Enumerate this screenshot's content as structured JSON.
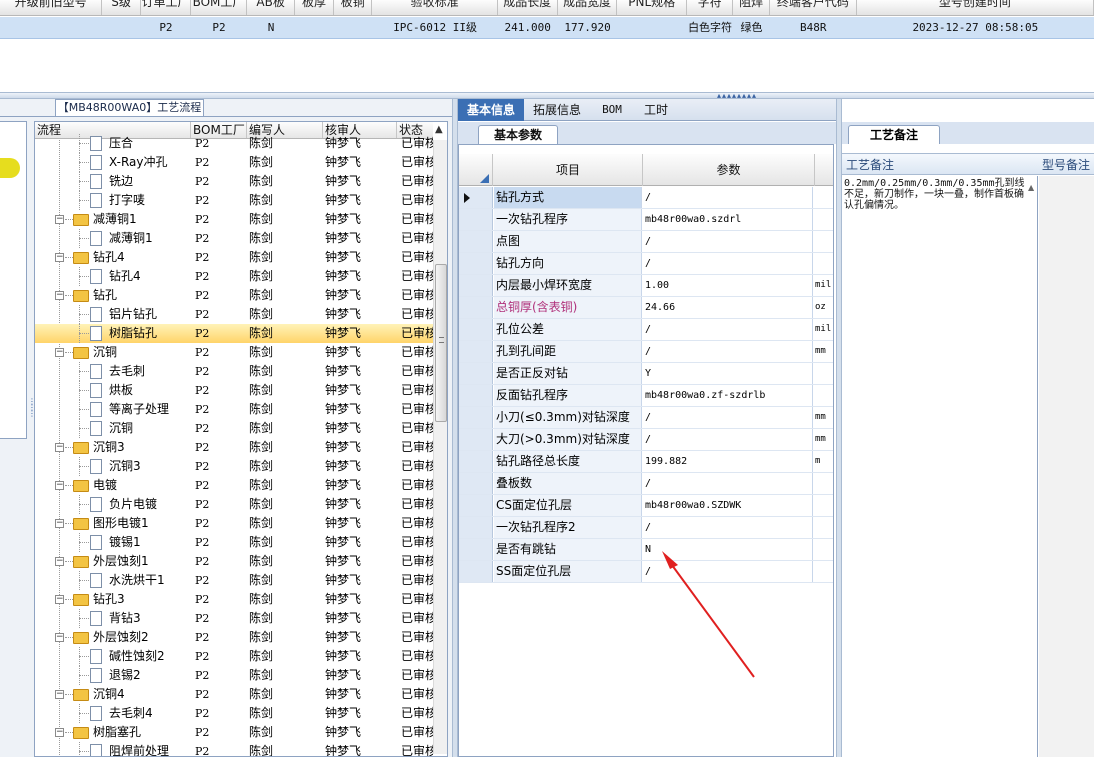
{
  "top_grid": {
    "headers": [
      "开级前旧型号",
      "S级",
      "订单工厂",
      "BOM工厂",
      "AB板",
      "板厚",
      "板铜",
      "验收标准",
      "成品长度",
      "成品宽度",
      "PNL规格",
      "字符",
      "阻焊",
      "终端客户代码",
      "型号创建时间"
    ],
    "row": [
      "",
      "",
      "P2",
      "P2",
      "N",
      "",
      "",
      "IPC-6012 II级",
      "241.000",
      "177.920",
      "",
      "白色字符",
      "绿色",
      "B48R",
      "2023-12-27 08:58:05"
    ]
  },
  "left_panel": {
    "tab_label": "【MB48R00WA0】工艺流程",
    "columns": [
      "流程",
      "BOM工厂",
      "编写人",
      "核审人",
      "状态"
    ],
    "rows": [
      {
        "level": 2,
        "name": "压合",
        "factory": "P2",
        "writer": "陈剑",
        "reviewer": "钟梦飞",
        "status": "已审核"
      },
      {
        "level": 2,
        "name": "X-Ray冲孔",
        "factory": "P2",
        "writer": "陈剑",
        "reviewer": "钟梦飞",
        "status": "已审核"
      },
      {
        "level": 2,
        "name": "铣边",
        "factory": "P2",
        "writer": "陈剑",
        "reviewer": "钟梦飞",
        "status": "已审核"
      },
      {
        "level": 2,
        "name": "打字唛",
        "factory": "P2",
        "writer": "陈剑",
        "reviewer": "钟梦飞",
        "status": "已审核"
      },
      {
        "level": 1,
        "name": "减薄铜1",
        "factory": "P2",
        "writer": "陈剑",
        "reviewer": "钟梦飞",
        "status": "已审核"
      },
      {
        "level": 2,
        "name": "减薄铜1",
        "factory": "P2",
        "writer": "陈剑",
        "reviewer": "钟梦飞",
        "status": "已审核"
      },
      {
        "level": 1,
        "name": "钻孔4",
        "factory": "P2",
        "writer": "陈剑",
        "reviewer": "钟梦飞",
        "status": "已审核"
      },
      {
        "level": 2,
        "name": "钻孔4",
        "factory": "P2",
        "writer": "陈剑",
        "reviewer": "钟梦飞",
        "status": "已审核"
      },
      {
        "level": 1,
        "name": "钻孔",
        "factory": "P2",
        "writer": "陈剑",
        "reviewer": "钟梦飞",
        "status": "已审核"
      },
      {
        "level": 2,
        "name": "铝片钻孔",
        "factory": "P2",
        "writer": "陈剑",
        "reviewer": "钟梦飞",
        "status": "已审核"
      },
      {
        "level": 2,
        "name": "树脂钻孔",
        "factory": "P2",
        "writer": "陈剑",
        "reviewer": "钟梦飞",
        "status": "已审核",
        "selected": true
      },
      {
        "level": 1,
        "name": "沉铜",
        "factory": "P2",
        "writer": "陈剑",
        "reviewer": "钟梦飞",
        "status": "已审核"
      },
      {
        "level": 2,
        "name": "去毛刺",
        "factory": "P2",
        "writer": "陈剑",
        "reviewer": "钟梦飞",
        "status": "已审核"
      },
      {
        "level": 2,
        "name": "烘板",
        "factory": "P2",
        "writer": "陈剑",
        "reviewer": "钟梦飞",
        "status": "已审核"
      },
      {
        "level": 2,
        "name": "等离子处理",
        "factory": "P2",
        "writer": "陈剑",
        "reviewer": "钟梦飞",
        "status": "已审核"
      },
      {
        "level": 2,
        "name": "沉铜",
        "factory": "P2",
        "writer": "陈剑",
        "reviewer": "钟梦飞",
        "status": "已审核"
      },
      {
        "level": 1,
        "name": "沉铜3",
        "factory": "P2",
        "writer": "陈剑",
        "reviewer": "钟梦飞",
        "status": "已审核"
      },
      {
        "level": 2,
        "name": "沉铜3",
        "factory": "P2",
        "writer": "陈剑",
        "reviewer": "钟梦飞",
        "status": "已审核"
      },
      {
        "level": 1,
        "name": "电镀",
        "factory": "P2",
        "writer": "陈剑",
        "reviewer": "钟梦飞",
        "status": "已审核"
      },
      {
        "level": 2,
        "name": "负片电镀",
        "factory": "P2",
        "writer": "陈剑",
        "reviewer": "钟梦飞",
        "status": "已审核"
      },
      {
        "level": 1,
        "name": "图形电镀1",
        "factory": "P2",
        "writer": "陈剑",
        "reviewer": "钟梦飞",
        "status": "已审核"
      },
      {
        "level": 2,
        "name": "镀锡1",
        "factory": "P2",
        "writer": "陈剑",
        "reviewer": "钟梦飞",
        "status": "已审核"
      },
      {
        "level": 1,
        "name": "外层蚀刻1",
        "factory": "P2",
        "writer": "陈剑",
        "reviewer": "钟梦飞",
        "status": "已审核"
      },
      {
        "level": 2,
        "name": "水洗烘干1",
        "factory": "P2",
        "writer": "陈剑",
        "reviewer": "钟梦飞",
        "status": "已审核"
      },
      {
        "level": 1,
        "name": "钻孔3",
        "factory": "P2",
        "writer": "陈剑",
        "reviewer": "钟梦飞",
        "status": "已审核"
      },
      {
        "level": 2,
        "name": "背钻3",
        "factory": "P2",
        "writer": "陈剑",
        "reviewer": "钟梦飞",
        "status": "已审核"
      },
      {
        "level": 1,
        "name": "外层蚀刻2",
        "factory": "P2",
        "writer": "陈剑",
        "reviewer": "钟梦飞",
        "status": "已审核"
      },
      {
        "level": 2,
        "name": "碱性蚀刻2",
        "factory": "P2",
        "writer": "陈剑",
        "reviewer": "钟梦飞",
        "status": "已审核"
      },
      {
        "level": 2,
        "name": "退锡2",
        "factory": "P2",
        "writer": "陈剑",
        "reviewer": "钟梦飞",
        "status": "已审核"
      },
      {
        "level": 1,
        "name": "沉铜4",
        "factory": "P2",
        "writer": "陈剑",
        "reviewer": "钟梦飞",
        "status": "已审核"
      },
      {
        "level": 2,
        "name": "去毛刺4",
        "factory": "P2",
        "writer": "陈剑",
        "reviewer": "钟梦飞",
        "status": "已审核"
      },
      {
        "level": 1,
        "name": "树脂塞孔",
        "factory": "P2",
        "writer": "陈剑",
        "reviewer": "钟梦飞",
        "status": "已审核"
      },
      {
        "level": 2,
        "name": "阻焊前处理",
        "factory": "P2",
        "writer": "陈剑",
        "reviewer": "钟梦飞",
        "status": "已审核"
      }
    ]
  },
  "middle_panel": {
    "tabs": [
      "基本信息",
      "拓展信息",
      "BOM",
      "工时"
    ],
    "active_tab": "基本信息",
    "sub_tab": "基本参数",
    "columns": [
      "项目",
      "参数"
    ],
    "rows": [
      {
        "name": "钻孔方式",
        "value": "/",
        "unit": ""
      },
      {
        "name": "一次钻孔程序",
        "value": "mb48r00wa0.szdrl",
        "unit": ""
      },
      {
        "name": "点图",
        "value": "/",
        "unit": ""
      },
      {
        "name": "钻孔方向",
        "value": "/",
        "unit": ""
      },
      {
        "name": "内层最小焊环宽度",
        "value": "1.00",
        "unit": "mil"
      },
      {
        "name": "总铜厚(含表铜)",
        "value": "24.66",
        "unit": "oz",
        "highlight": true
      },
      {
        "name": "孔位公差",
        "value": "/",
        "unit": "mil"
      },
      {
        "name": "孔到孔间距",
        "value": "/",
        "unit": "mm"
      },
      {
        "name": "是否正反对钻",
        "value": "Y",
        "unit": ""
      },
      {
        "name": "反面钻孔程序",
        "value": "mb48r00wa0.zf-szdrlb",
        "unit": ""
      },
      {
        "name": "小刀(≤0.3mm)对钻深度",
        "value": "/",
        "unit": "mm"
      },
      {
        "name": "大刀(>0.3mm)对钻深度",
        "value": "/",
        "unit": "mm"
      },
      {
        "name": "钻孔路径总长度",
        "value": "199.882",
        "unit": "m"
      },
      {
        "name": "叠板数",
        "value": "/",
        "unit": ""
      },
      {
        "name": "CS面定位孔层",
        "value": "mb48r00wa0.SZDWK",
        "unit": ""
      },
      {
        "name": "一次钻孔程序2",
        "value": "/",
        "unit": ""
      },
      {
        "name": "是否有跳钻",
        "value": "N",
        "unit": ""
      },
      {
        "name": "SS面定位孔层",
        "value": "/",
        "unit": ""
      }
    ]
  },
  "right_panel": {
    "tab": "工艺备注",
    "columns": [
      "工艺备注",
      "型号备注"
    ],
    "note": "0.2mm/0.25mm/0.3mm/0.35mm孔到线不足，新刀制作，一块一叠，制作首板确认孔偏情况。"
  },
  "colors": {
    "accent": "#3b6fb4",
    "selected_row": "#ffd46a",
    "highlight_text": "#b0307a",
    "annotation_arrow": "#e02020"
  }
}
